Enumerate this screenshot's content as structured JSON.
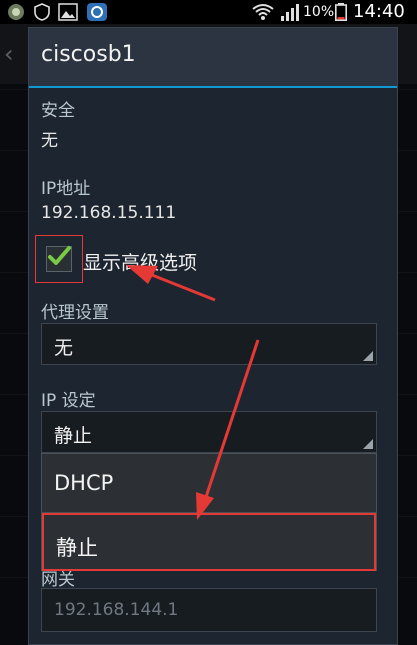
{
  "status_bar": {
    "battery_percent": "10%",
    "time": "14:40"
  },
  "dialog": {
    "title": "ciscosb1",
    "security_label": "安全",
    "security_value": "无",
    "ip_label": "IP地址",
    "ip_value": "192.168.15.111",
    "show_advanced_label": "显示高级选项",
    "show_advanced_checked": true,
    "proxy_label": "代理设置",
    "proxy_value": "无",
    "ip_settings_label": "IP 设定",
    "ip_settings_value": "静止",
    "ip_settings_options": [
      "DHCP",
      "静止"
    ],
    "gateway_label": "网关",
    "gateway_placeholder": "192.168.144.1"
  },
  "colors": {
    "accent": "#0f9bd1",
    "annotation": "#e53935",
    "checkmark": "#7ac943"
  }
}
